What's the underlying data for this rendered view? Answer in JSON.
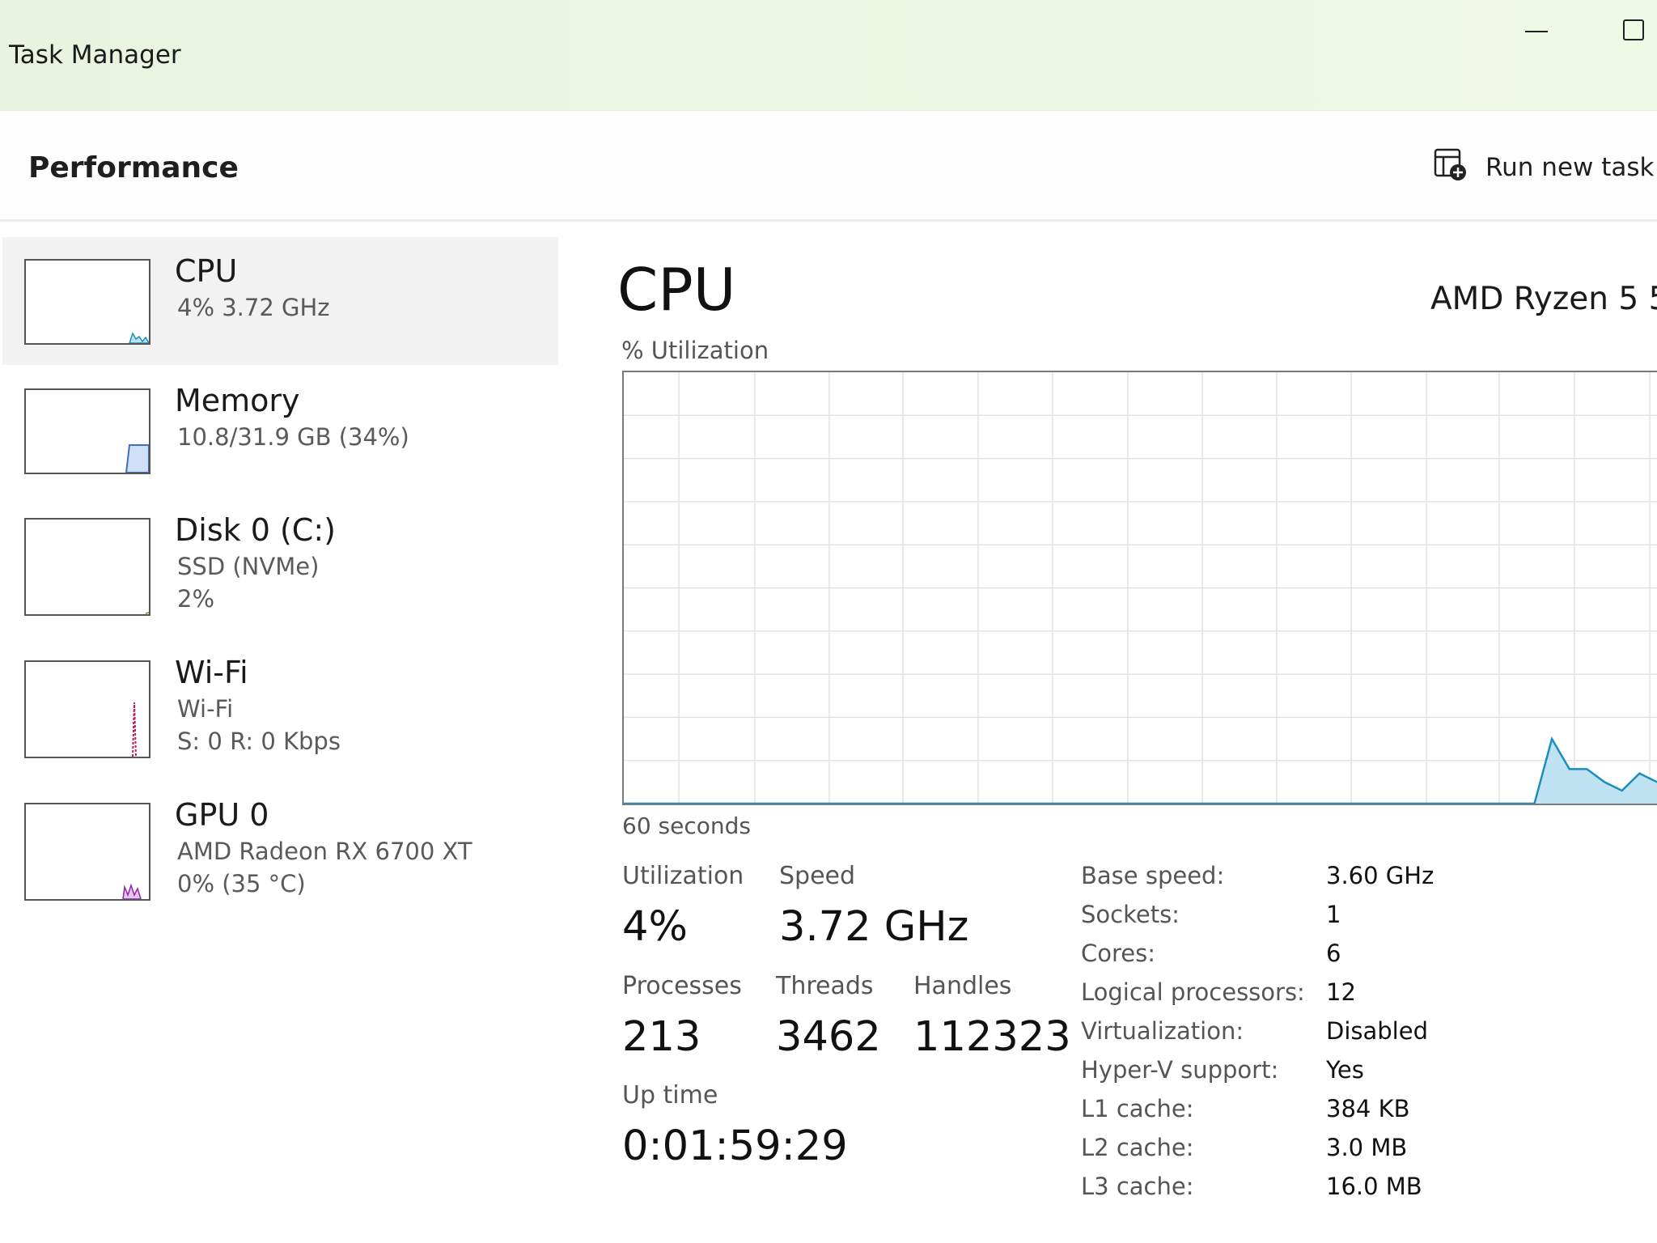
{
  "window": {
    "title": "Task Manager"
  },
  "header": {
    "page_title": "Performance",
    "run_task_label": "Run new task"
  },
  "sidebar": {
    "items": [
      {
        "name": "CPU",
        "line1": "4%  3.72 GHz",
        "line2": "",
        "graph_color": "#1a8fbf",
        "selected": true
      },
      {
        "name": "Memory",
        "line1": "10.8/31.9 GB (34%)",
        "line2": "",
        "graph_color": "#3b6fc4",
        "usage_fraction": 0.34
      },
      {
        "name": "Disk 0 (C:)",
        "line1": "SSD (NVMe)",
        "line2": "2%",
        "graph_color": "#4e9a06"
      },
      {
        "name": "Wi-Fi",
        "line1": "Wi-Fi",
        "line2": "S: 0  R: 0 Kbps",
        "graph_color": "#c2185b"
      },
      {
        "name": "GPU 0",
        "line1": "AMD Radeon RX 6700 XT",
        "line2": "0%  (35 °C)",
        "graph_color": "#8e24aa"
      }
    ]
  },
  "main": {
    "title": "CPU",
    "model": "AMD Ryzen 5 5",
    "graph_label": "% Utilization",
    "graph_duration": "60 seconds",
    "graph_color": "#1a8fbf",
    "graph_fill": "#bfe3f2",
    "graph_series_percent": [
      0,
      0,
      0,
      0,
      0,
      0,
      0,
      0,
      0,
      0,
      0,
      0,
      0,
      0,
      0,
      0,
      0,
      0,
      0,
      0,
      0,
      0,
      0,
      0,
      0,
      0,
      0,
      0,
      0,
      0,
      0,
      0,
      0,
      0,
      0,
      0,
      0,
      0,
      0,
      0,
      0,
      0,
      0,
      0,
      0,
      0,
      0,
      0,
      0,
      0,
      0,
      0,
      0,
      15,
      8,
      8,
      5,
      3,
      7,
      5
    ],
    "stats": {
      "utilization": {
        "label": "Utilization",
        "value": "4%"
      },
      "speed": {
        "label": "Speed",
        "value": "3.72 GHz"
      },
      "processes": {
        "label": "Processes",
        "value": "213"
      },
      "threads": {
        "label": "Threads",
        "value": "3462"
      },
      "handles": {
        "label": "Handles",
        "value": "112323"
      },
      "uptime": {
        "label": "Up time",
        "value": "0:01:59:29"
      }
    },
    "specs": [
      {
        "key": "Base speed:",
        "value": "3.60 GHz"
      },
      {
        "key": "Sockets:",
        "value": "1"
      },
      {
        "key": "Cores:",
        "value": "6"
      },
      {
        "key": "Logical processors:",
        "value": "12"
      },
      {
        "key": "Virtualization:",
        "value": "Disabled"
      },
      {
        "key": "Hyper-V support:",
        "value": "Yes"
      },
      {
        "key": "L1 cache:",
        "value": "384 KB"
      },
      {
        "key": "L2 cache:",
        "value": "3.0 MB"
      },
      {
        "key": "L3 cache:",
        "value": "16.0 MB"
      }
    ]
  }
}
